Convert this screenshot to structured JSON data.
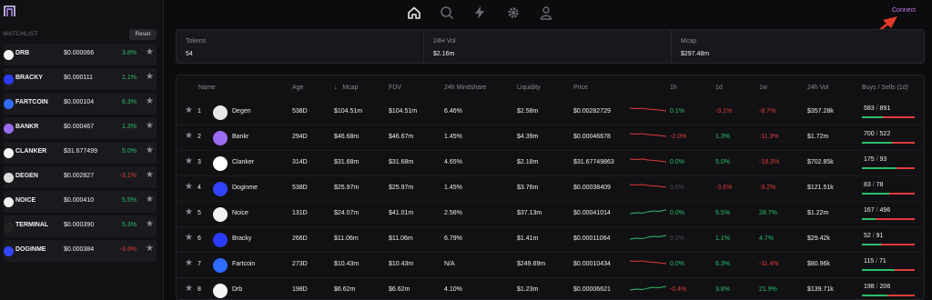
{
  "nav": {
    "icons": [
      "home-icon",
      "search-icon",
      "bolt-icon",
      "settings-icon",
      "user-icon"
    ],
    "connect_label": "Connect"
  },
  "watchlist": {
    "title": "WATCHLIST",
    "reset_label": "Reset",
    "items": [
      {
        "symbol": "DRB",
        "price": "$0.000066",
        "change": "3.8%",
        "dir": "pos",
        "icon_color": "#f5f5f5"
      },
      {
        "symbol": "BRACKY",
        "price": "$0.000111",
        "change": "1.1%",
        "dir": "pos",
        "icon_color": "#2b3cff"
      },
      {
        "symbol": "FARTCOIN",
        "price": "$0.000104",
        "change": "6.3%",
        "dir": "pos",
        "icon_color": "#2f6bff"
      },
      {
        "symbol": "BANKR",
        "price": "$0.000467",
        "change": "1.3%",
        "dir": "pos",
        "icon_color": "#9b6cf0"
      },
      {
        "symbol": "CLANKER",
        "price": "$31.677499",
        "change": "5.0%",
        "dir": "pos",
        "icon_color": "#ffffff"
      },
      {
        "symbol": "DEGEN",
        "price": "$0.002827",
        "change": "-3.1%",
        "dir": "neg",
        "icon_color": "#dcdcdc"
      },
      {
        "symbol": "NOICE",
        "price": "$0.000410",
        "change": "5.5%",
        "dir": "pos",
        "icon_color": "#f2f2f2"
      },
      {
        "symbol": "TERMINAL",
        "price": "$0.000390",
        "change": "5.3%",
        "dir": "pos",
        "icon_color": "#222222"
      },
      {
        "symbol": "DOGINME",
        "price": "$0.000384",
        "change": "-3.6%",
        "dir": "neg",
        "icon_color": "#3344ff"
      }
    ]
  },
  "stats": [
    {
      "label": "Tokens",
      "value": "54"
    },
    {
      "label": "24H Vol",
      "value": "$2.16m"
    },
    {
      "label": "Mcap",
      "value": "$297.48m"
    }
  ],
  "table": {
    "headers": {
      "name": "Name",
      "age": "Age",
      "mcap": "Mcap",
      "fdv": "FDV",
      "mindshare": "24h Mindshare",
      "liquidity": "Liquidity",
      "price": "Price",
      "h1": "1h",
      "d1": "1d",
      "w1": "1w",
      "vol": "24h Vol",
      "buys_sells": "Buys / Sells (1d)"
    },
    "sort_indicator": "↓",
    "rows": [
      {
        "rank": "1",
        "name": "Degen",
        "age": "538D",
        "mcap": "$104.51m",
        "fdv": "$104.51m",
        "mindshare": "6.46%",
        "liquidity": "$2.58m",
        "price": "$0.00282729",
        "h1": "0.1%",
        "h1_dir": "pos",
        "d1": "-3.1%",
        "d1_dir": "neg",
        "w1": "-8.7%",
        "w1_dir": "neg",
        "vol": "$357.28k",
        "buys": "583",
        "sells": "891",
        "buy_frac": 0.4,
        "spark": "neg",
        "avatar_color": "#e8e8e8"
      },
      {
        "rank": "2",
        "name": "Bankr",
        "age": "294D",
        "mcap": "$46.68m",
        "fdv": "$46.67m",
        "mindshare": "1.45%",
        "liquidity": "$4.39m",
        "price": "$0.00046678",
        "h1": "-2.0%",
        "h1_dir": "neg",
        "d1": "1.3%",
        "d1_dir": "pos",
        "w1": "-11.3%",
        "w1_dir": "neg",
        "vol": "$1.72m",
        "buys": "700",
        "sells": "522",
        "buy_frac": 0.57,
        "spark": "neg",
        "avatar_color": "#9b6cf0"
      },
      {
        "rank": "3",
        "name": "Clanker",
        "age": "314D",
        "mcap": "$31.68m",
        "fdv": "$31.68m",
        "mindshare": "4.65%",
        "liquidity": "$2.18m",
        "price": "$31.67749863",
        "h1": "0.0%",
        "h1_dir": "pos",
        "d1": "5.0%",
        "d1_dir": "pos",
        "w1": "-18.3%",
        "w1_dir": "neg",
        "vol": "$702.85k",
        "buys": "175",
        "sells": "93",
        "buy_frac": 0.65,
        "spark": "neg",
        "avatar_color": "#ffffff"
      },
      {
        "rank": "4",
        "name": "Doginme",
        "age": "538D",
        "mcap": "$25.97m",
        "fdv": "$25.97m",
        "mindshare": "1.45%",
        "liquidity": "$3.76m",
        "price": "$0.00038409",
        "h1": "0.0%",
        "h1_dir": "dim",
        "d1": "-3.6%",
        "d1_dir": "neg",
        "w1": "-9.2%",
        "w1_dir": "neg",
        "vol": "$121.51k",
        "buys": "83",
        "sells": "78",
        "buy_frac": 0.52,
        "spark": "neg",
        "avatar_color": "#3344ff"
      },
      {
        "rank": "5",
        "name": "Noice",
        "age": "131D",
        "mcap": "$24.07m",
        "fdv": "$41.01m",
        "mindshare": "2.56%",
        "liquidity": "$37.13m",
        "price": "$0.00041014",
        "h1": "0.0%",
        "h1_dir": "pos",
        "d1": "5.5%",
        "d1_dir": "pos",
        "w1": "28.7%",
        "w1_dir": "pos",
        "vol": "$1.22m",
        "buys": "167",
        "sells": "496",
        "buy_frac": 0.25,
        "spark": "pos",
        "avatar_color": "#f2f2f2"
      },
      {
        "rank": "6",
        "name": "Bracky",
        "age": "266D",
        "mcap": "$11.06m",
        "fdv": "$11.06m",
        "mindshare": "6.79%",
        "liquidity": "$1.41m",
        "price": "$0.00011064",
        "h1": "0.0%",
        "h1_dir": "dim",
        "d1": "1.1%",
        "d1_dir": "pos",
        "w1": "4.7%",
        "w1_dir": "pos",
        "vol": "$29.42k",
        "buys": "52",
        "sells": "91",
        "buy_frac": 0.36,
        "spark": "pos",
        "avatar_color": "#2b3cff"
      },
      {
        "rank": "7",
        "name": "Fartcoin",
        "age": "273D",
        "mcap": "$10.43m",
        "fdv": "$10.43m",
        "mindshare": "N/A",
        "liquidity": "$249.69m",
        "price": "$0.00010434",
        "h1": "0.0%",
        "h1_dir": "pos",
        "d1": "6.3%",
        "d1_dir": "pos",
        "w1": "-11.4%",
        "w1_dir": "neg",
        "vol": "$80.96k",
        "buys": "115",
        "sells": "71",
        "buy_frac": 0.62,
        "spark": "neg",
        "avatar_color": "#2f6bff"
      },
      {
        "rank": "8",
        "name": "Drb",
        "age": "198D",
        "mcap": "$6.62m",
        "fdv": "$6.62m",
        "mindshare": "4.10%",
        "liquidity": "$1.23m",
        "price": "$0.00006621",
        "h1": "-0.4%",
        "h1_dir": "neg",
        "d1": "3.8%",
        "d1_dir": "pos",
        "w1": "21.9%",
        "w1_dir": "pos",
        "vol": "$139.71k",
        "buys": "198",
        "sells": "206",
        "buy_frac": 0.49,
        "spark": "pos",
        "avatar_color": "#f5f5f5"
      }
    ]
  }
}
